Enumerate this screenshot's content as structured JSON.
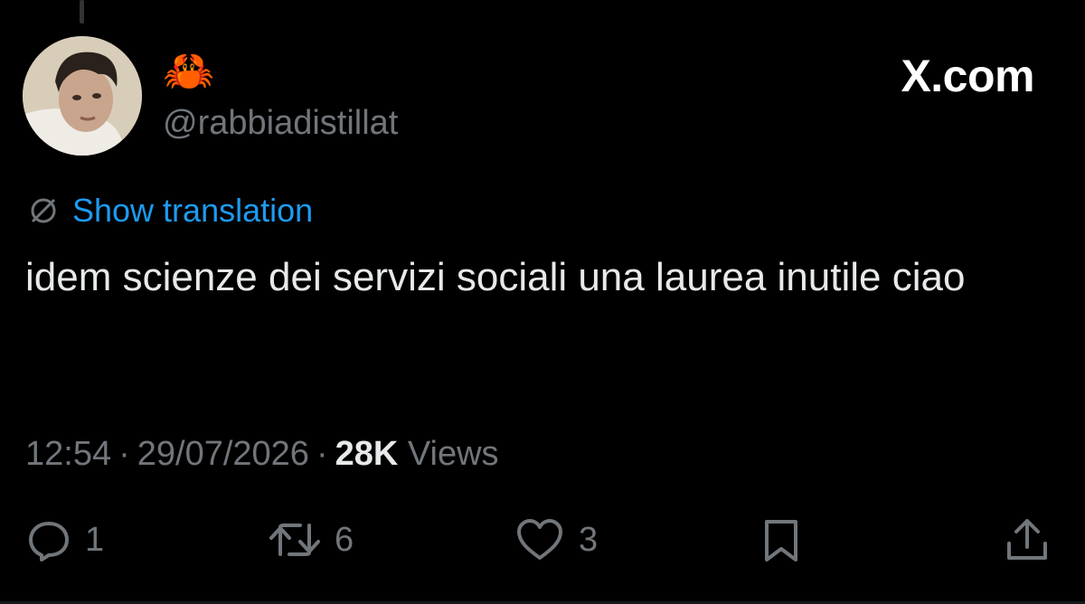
{
  "author": {
    "display_name": "🦀",
    "handle": "@rabbiadistillat"
  },
  "brand": {
    "label": "X.com"
  },
  "translation": {
    "label": "Show translation"
  },
  "tweet": {
    "text": "idem scienze dei servizi sociali una laurea inutile ciao"
  },
  "meta": {
    "time": "12:54",
    "date": "29/07/2026",
    "views_count": "28K",
    "views_label": "Views",
    "separator": "·"
  },
  "actions": {
    "reply": {
      "icon": "reply-icon",
      "count": "1"
    },
    "repost": {
      "icon": "repost-icon",
      "count": "6"
    },
    "like": {
      "icon": "heart-icon",
      "count": "3"
    },
    "bookmark": {
      "icon": "bookmark-icon"
    },
    "share": {
      "icon": "share-icon"
    }
  },
  "colors": {
    "background": "#000000",
    "text": "#e7e9ea",
    "muted": "#71767b",
    "link": "#1d9bf0"
  }
}
